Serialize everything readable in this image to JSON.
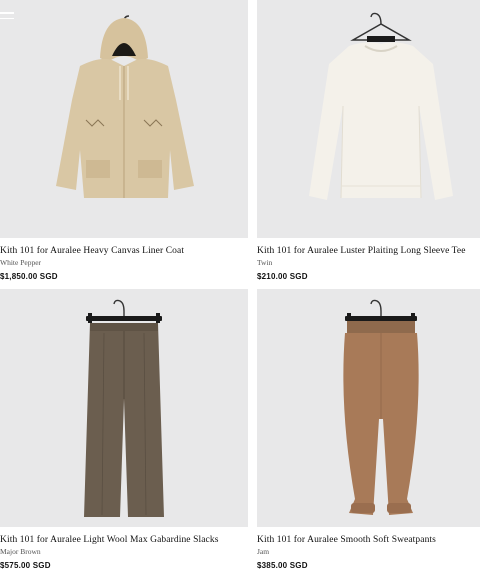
{
  "products": [
    {
      "name": "Kith 101 for Auralee Heavy Canvas Liner Coat",
      "color": "White Pepper",
      "price": "$1,850.00 SGD",
      "image_icon": "coat-icon",
      "swatch": "#d9c7a4"
    },
    {
      "name": "Kith 101 for Auralee Luster Plaiting Long Sleeve Tee",
      "color": "Twin",
      "price": "$210.00 SGD",
      "image_icon": "long-sleeve-tee-icon",
      "swatch": "#f2efe7"
    },
    {
      "name": "Kith 101 for Auralee Light Wool Max Gabardine Slacks",
      "color": "Major Brown",
      "price": "$575.00 SGD",
      "image_icon": "slacks-icon",
      "swatch": "#6b5e4f"
    },
    {
      "name": "Kith 101 for Auralee Smooth Soft Sweatpants",
      "color": "Jam",
      "price": "$385.00 SGD",
      "image_icon": "sweatpants-icon",
      "swatch": "#a87a58"
    }
  ]
}
